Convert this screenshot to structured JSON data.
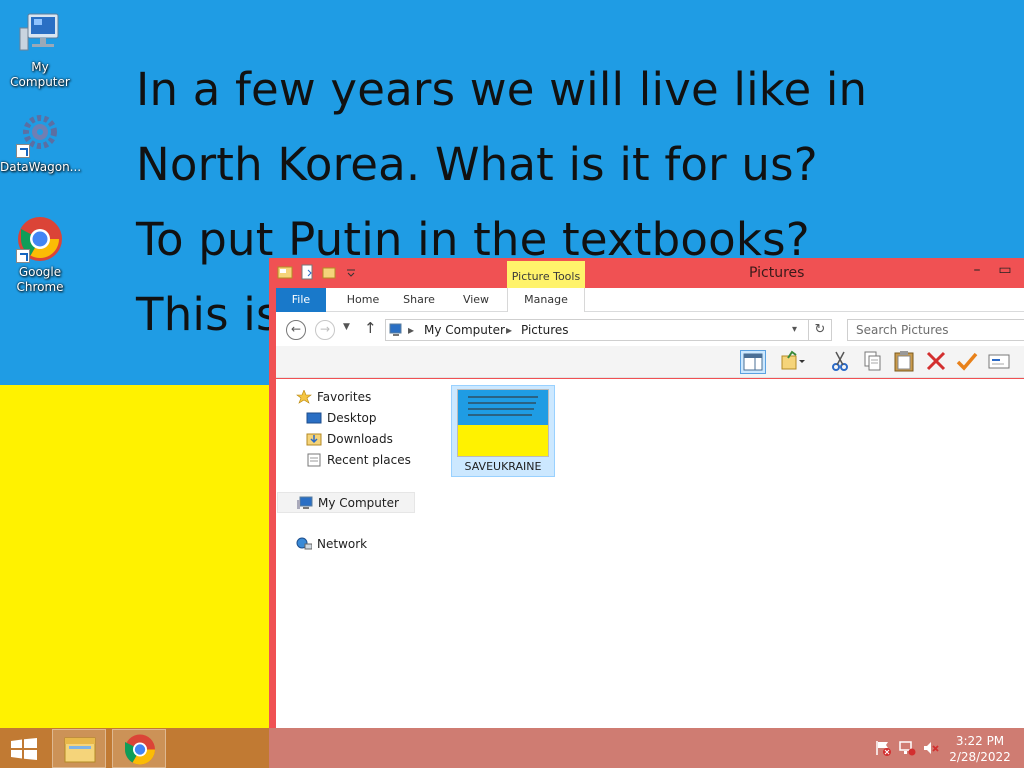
{
  "wallpaper": {
    "text_lines": [
      "In a few years we will live like in",
      "North Korea. What is it for us?",
      "To put Putin in the textbooks?",
      "This is"
    ],
    "colors": {
      "top": "#1f9ce4",
      "bottom": "#fff200"
    }
  },
  "desktop": {
    "icons": [
      {
        "label": "My Computer",
        "icon": "computer-icon"
      },
      {
        "label": "DataWagon...",
        "icon": "gear-icon"
      },
      {
        "label": "Google Chrome",
        "icon": "chrome-icon"
      }
    ]
  },
  "explorer": {
    "title": "Pictures",
    "context_tab": "Picture Tools",
    "tabs": [
      "File",
      "Home",
      "Share",
      "View",
      "Manage"
    ],
    "breadcrumb": [
      "My Computer",
      "Pictures"
    ],
    "search_placeholder": "Search Pictures",
    "nav": {
      "favorites": "Favorites",
      "desktop": "Desktop",
      "downloads": "Downloads",
      "recent": "Recent places",
      "computer": "My Computer",
      "network": "Network"
    },
    "files": [
      {
        "name": "SAVEUKRAINE",
        "selected": true
      }
    ],
    "accent_color": "#f05153"
  },
  "taskbar": {
    "time": "3:22 PM",
    "date": "2/28/2022"
  }
}
